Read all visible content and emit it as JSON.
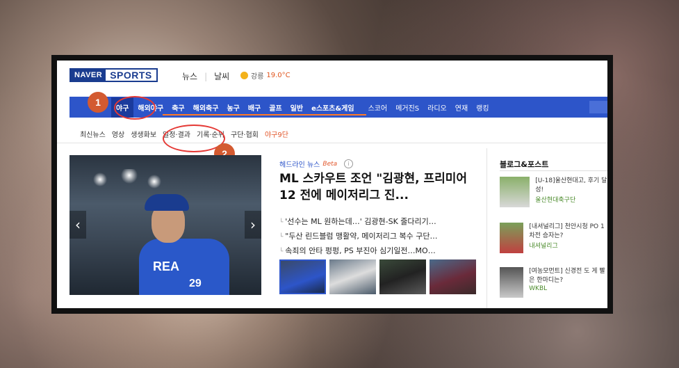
{
  "header": {
    "logo_naver": "NAVER",
    "logo_sports": "SPORTS",
    "links": [
      "뉴스",
      "날씨"
    ],
    "weather_city": "강릉",
    "weather_temp": "19.0°C"
  },
  "nav": {
    "items": [
      "야구",
      "해외야구",
      "축구",
      "해외축구",
      "농구",
      "배구",
      "골프",
      "일반",
      "e스포츠&게임",
      "스코어",
      "메거진S",
      "라디오",
      "연재",
      "랭킹"
    ],
    "active": "야구"
  },
  "subnav": {
    "items": [
      "최신뉴스",
      "영상",
      "생생화보",
      "일정·결과",
      "기록·순위",
      "구단·협회",
      "야구9단"
    ]
  },
  "annotations": {
    "badge1": "1",
    "badge2": "2"
  },
  "headline": {
    "section_label": "헤드라인 뉴스",
    "beta": "Beta",
    "info": "i",
    "title": "ML 스카우트 조언 \"김광현, 프리미어 12 전에 메이저리그 진...",
    "items": [
      "'선수는 ML 원하는데…' 김광현-SK 줄다리기…",
      "\"두산 린드블럼 맹활약, 메이저리그 복수 구단…",
      "속죄의 안타 펑펑, PS 부진아 심기일전…MO…"
    ]
  },
  "photo": {
    "jersey": "REA",
    "number": "29",
    "prev": "‹",
    "next": "›"
  },
  "blog": {
    "title": "블로그&포스트",
    "posts": [
      {
        "text": "[U-18]울산현대고, 후기 달성!",
        "source": "울산현대축구단"
      },
      {
        "text": "[내셔널리그] 천안시청 PO 1차전 승자는?",
        "source": "내셔널리그"
      },
      {
        "text": "[여농모먼트] 신경전 도 게 빨은 한마디는?",
        "source": "WKBL"
      }
    ]
  },
  "colors": {
    "nav_bg": "#2d55c9",
    "accent": "#ff7a26",
    "annotation": "#d35a30"
  }
}
